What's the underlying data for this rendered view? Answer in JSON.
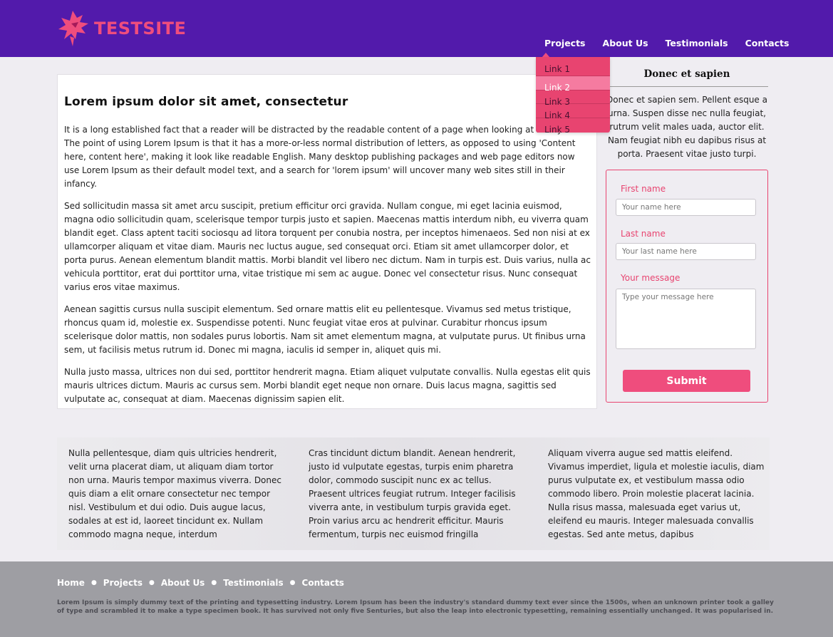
{
  "header": {
    "logo": {
      "text_a": "TEST",
      "text_b": "SITE"
    },
    "nav": [
      {
        "label": "Projects"
      },
      {
        "label": "About Us"
      },
      {
        "label": "Testimonials"
      },
      {
        "label": "Contacts"
      }
    ],
    "dropdown": {
      "items": [
        {
          "label": "Link 1"
        },
        {
          "label": "Link 2"
        },
        {
          "label": "Link 3"
        },
        {
          "label": "Link 4"
        },
        {
          "label": "Link 5"
        }
      ],
      "active_index": 1
    }
  },
  "article": {
    "title": "Lorem ipsum dolor sit amet, consectetur",
    "paragraphs": [
      "It is a long established fact that a reader will be distracted by the readable content of a page when looking at its layout. The point of using Lorem Ipsum is that it has a more-or-less normal distribution of letters, as opposed to using 'Content here, content here', making it look like readable English. Many desktop publishing packages and web page editors now use Lorem Ipsum as their default model text, and a search for 'lorem ipsum' will uncover many web sites still in their infancy.",
      "Sed sollicitudin massa sit amet arcu suscipit, pretium efficitur orci gravida. Nullam congue, mi eget lacinia euismod, magna odio sollicitudin quam, scelerisque tempor turpis justo et sapien. Maecenas mattis interdum nibh, eu viverra quam blandit eget. Class aptent taciti sociosqu ad litora torquent per conubia nostra, per inceptos himenaeos. Sed non nisi at ex ullamcorper aliquam et vitae diam. Mauris nec luctus augue, sed consequat orci. Etiam sit amet ullamcorper dolor, et porta purus. Aenean elementum blandit mattis. Morbi blandit vel libero nec dictum. Nam in turpis est. Duis varius, nulla ac vehicula porttitor, erat dui porttitor urna, vitae tristique mi sem ac augue. Donec vel consectetur risus. Nunc consequat varius eros vitae maximus.",
      "Aenean sagittis cursus nulla suscipit elementum. Sed ornare mattis elit eu pellentesque. Vivamus sed metus tristique, rhoncus quam id, molestie ex. Suspendisse potenti. Nunc feugiat vitae eros at pulvinar. Curabitur rhoncus ipsum scelerisque dolor mattis, non sodales purus lobortis. Nam sit amet elementum magna, at vulputate purus. Ut finibus urna sem, ut facilisis metus rutrum id. Donec mi magna, iaculis id semper in, aliquet quis mi.",
      "Nulla justo massa, ultrices non dui sed, porttitor hendrerit magna. Etiam aliquet vulputate convallis. Nulla egestas elit quis mauris ultrices dictum. Mauris ac cursus sem. Morbi blandit eget neque non ornare. Duis lacus magna, sagittis sed vulputate ac, consequat at diam. Maecenas dignissim sapien elit."
    ]
  },
  "sidebar": {
    "title": "Donec et sapien",
    "text": "Donec et sapien sem. Pellent esque a urna. Suspen disse nec nulla feugiat, rutrum velit males uada, auctor elit. Nam feugiat nibh eu dapibus risus at porta. Praesent vitae justo turpi.",
    "form": {
      "first_name_label": "First name",
      "first_name_placeholder": "Your name here",
      "last_name_label": "Last name",
      "last_name_placeholder": "Your last name here",
      "message_label": "Your message",
      "message_placeholder": "Type your message here",
      "submit_label": "Submit"
    }
  },
  "columns": [
    "Nulla pellentesque, diam quis ultricies hendrerit, velit urna placerat diam, ut aliquam diam tortor non urna. Mauris tempor maximus viverra. Donec quis diam a elit ornare consectetur nec tempor nisl. Vestibulum et dui odio. Duis augue lacus, sodales at est id, laoreet tincidunt ex. Nullam commodo magna neque, interdum",
    "Cras tincidunt dictum blandit. Aenean hendrerit, justo id vulputate egestas, turpis enim pharetra dolor, commodo suscipit nunc ex ac tellus. Praesent ultrices feugiat rutrum. Integer facilisis viverra ante, in vestibulum turpis gravida eget. Proin varius arcu ac hendrerit efficitur. Mauris fermentum, turpis nec euismod fringilla",
    "Aliquam viverra augue sed mattis eleifend. Vivamus imperdiet, ligula et molestie iaculis, diam purus vulputate ex, et vestibulum massa odio commodo libero. Proin molestie placerat lacinia. Nulla risus massa, malesuada eget varius ut, eleifend eu mauris. Integer malesuada convallis egestas. Sed ante metus, dapibus"
  ],
  "footer": {
    "nav": [
      {
        "label": "Home"
      },
      {
        "label": "Projects"
      },
      {
        "label": "About Us"
      },
      {
        "label": "Testimonials"
      },
      {
        "label": "Contacts"
      }
    ],
    "separator": "●",
    "text": "Lorem Ipsum is simply dummy text of the printing and typesetting industry. Lorem Ipsum has been the industry's standard dummy text ever since the 1500s, when an unknown printer took a galley of type and scrambled it to make a type specimen book. It has survived not only five Senturies, but also the leap into electronic typesetting, remaining essentially unchanged. It was popularised in."
  },
  "colors": {
    "header_bg": "#521aab",
    "accent": "#ef4d7d",
    "dropdown_bg": "#e84470",
    "dropdown_active": "#f57ba0",
    "footer_bg": "#9e9ea3",
    "page_bg": "#efedf2"
  },
  "icons": {
    "logo": "dragon-logo-icon"
  }
}
